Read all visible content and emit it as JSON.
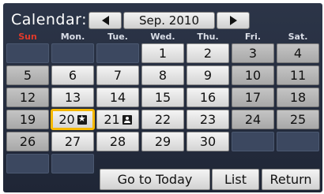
{
  "header": {
    "title": "Calendar:",
    "month_label": "Sep. 2010",
    "prev_icon": "left-triangle",
    "next_icon": "right-triangle"
  },
  "weekdays": [
    "Sun",
    "Mon.",
    "Tue.",
    "Wed.",
    "Thu.",
    "Fri.",
    "Sat."
  ],
  "selected_day": "20",
  "days": {
    "d1": "1",
    "d2": "2",
    "d3": "3",
    "d4": "4",
    "d5": "5",
    "d6": "6",
    "d7": "7",
    "d8": "8",
    "d9": "9",
    "d10": "10",
    "d11": "11",
    "d12": "12",
    "d13": "13",
    "d14": "14",
    "d15": "15",
    "d16": "16",
    "d17": "17",
    "d18": "18",
    "d19": "19",
    "d20": "20",
    "d21": "21",
    "d22": "22",
    "d23": "23",
    "d24": "24",
    "d25": "25",
    "d26": "26",
    "d27": "27",
    "d28": "28",
    "d29": "29",
    "d30": "30"
  },
  "event_icons": {
    "d20": "star-icon",
    "d21": "person-icon"
  },
  "actions": {
    "today": "Go to Today",
    "list": "List",
    "return": "Return"
  },
  "colors": {
    "sunday": "#e03a2a",
    "selected_outline": "#f5b800",
    "background": "#2c3548"
  }
}
